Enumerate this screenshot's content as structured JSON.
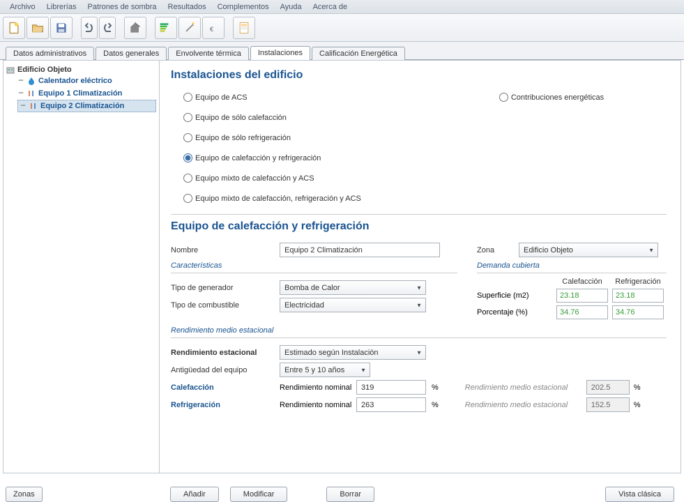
{
  "menu": {
    "items": [
      "Archivo",
      "Librerías",
      "Patrones de sombra",
      "Resultados",
      "Complementos",
      "Ayuda",
      "Acerca de"
    ]
  },
  "tabs": {
    "items": [
      "Datos administrativos",
      "Datos generales",
      "Envolvente térmica",
      "Instalaciones",
      "Calificación Energética"
    ],
    "active": 3
  },
  "tree": {
    "root": "Edificio Objeto",
    "children": [
      {
        "label": "Calentador eléctrico"
      },
      {
        "label": "Equipo 1 Climatización"
      },
      {
        "label": "Equipo 2 Climatización",
        "selected": true
      }
    ]
  },
  "zonas_button": "Zonas",
  "content": {
    "title1": "Instalaciones del edificio",
    "radios_left": [
      "Equipo de ACS",
      "Equipo de sólo calefacción",
      "Equipo de sólo refrigeración",
      "Equipo de calefacción y refrigeración",
      "Equipo mixto de calefacción y ACS",
      "Equipo mixto de calefacción, refrigeración y ACS"
    ],
    "radio_selected": 3,
    "radio_right": "Contribuciones energéticas",
    "title2": "Equipo de calefacción y refrigeración",
    "nombre_label": "Nombre",
    "nombre_value": "Equipo 2 Climatización",
    "zona_label": "Zona",
    "zona_value": "Edificio Objeto",
    "caracteristicas_legend": "Características",
    "tipo_generador_label": "Tipo de generador",
    "tipo_generador_value": "Bomba de Calor",
    "tipo_combustible_label": "Tipo de combustible",
    "tipo_combustible_value": "Electricidad",
    "demanda_legend": "Demanda cubierta",
    "demanda_head_cal": "Calefacción",
    "demanda_head_ref": "Refrigeración",
    "demanda_sup_label": "Superficie (m2)",
    "demanda_sup_cal": "23.18",
    "demanda_sup_ref": "23.18",
    "demanda_por_label": "Porcentaje (%)",
    "demanda_por_cal": "34.76",
    "demanda_por_ref": "34.76",
    "rend_legend": "Rendimiento medio estacional",
    "rend_estacional_label": "Rendimiento estacional",
    "rend_estacional_value": "Estimado según Instalación",
    "antiguedad_label": "Antigüedad del equipo",
    "antiguedad_value": "Entre 5 y 10 años",
    "cal_label": "Calefacción",
    "ref_label": "Refrigeración",
    "rend_nominal_label": "Rendimiento nominal",
    "rend_nominal_cal": "319",
    "rend_nominal_ref": "263",
    "percent": "%",
    "rend_medio_label": "Rendimiento medio estacional",
    "rend_medio_cal": "202.5",
    "rend_medio_ref": "152.5"
  },
  "buttons": {
    "anadir": "Añadir",
    "modificar": "Modificar",
    "borrar": "Borrar",
    "vista": "Vista clásica"
  }
}
